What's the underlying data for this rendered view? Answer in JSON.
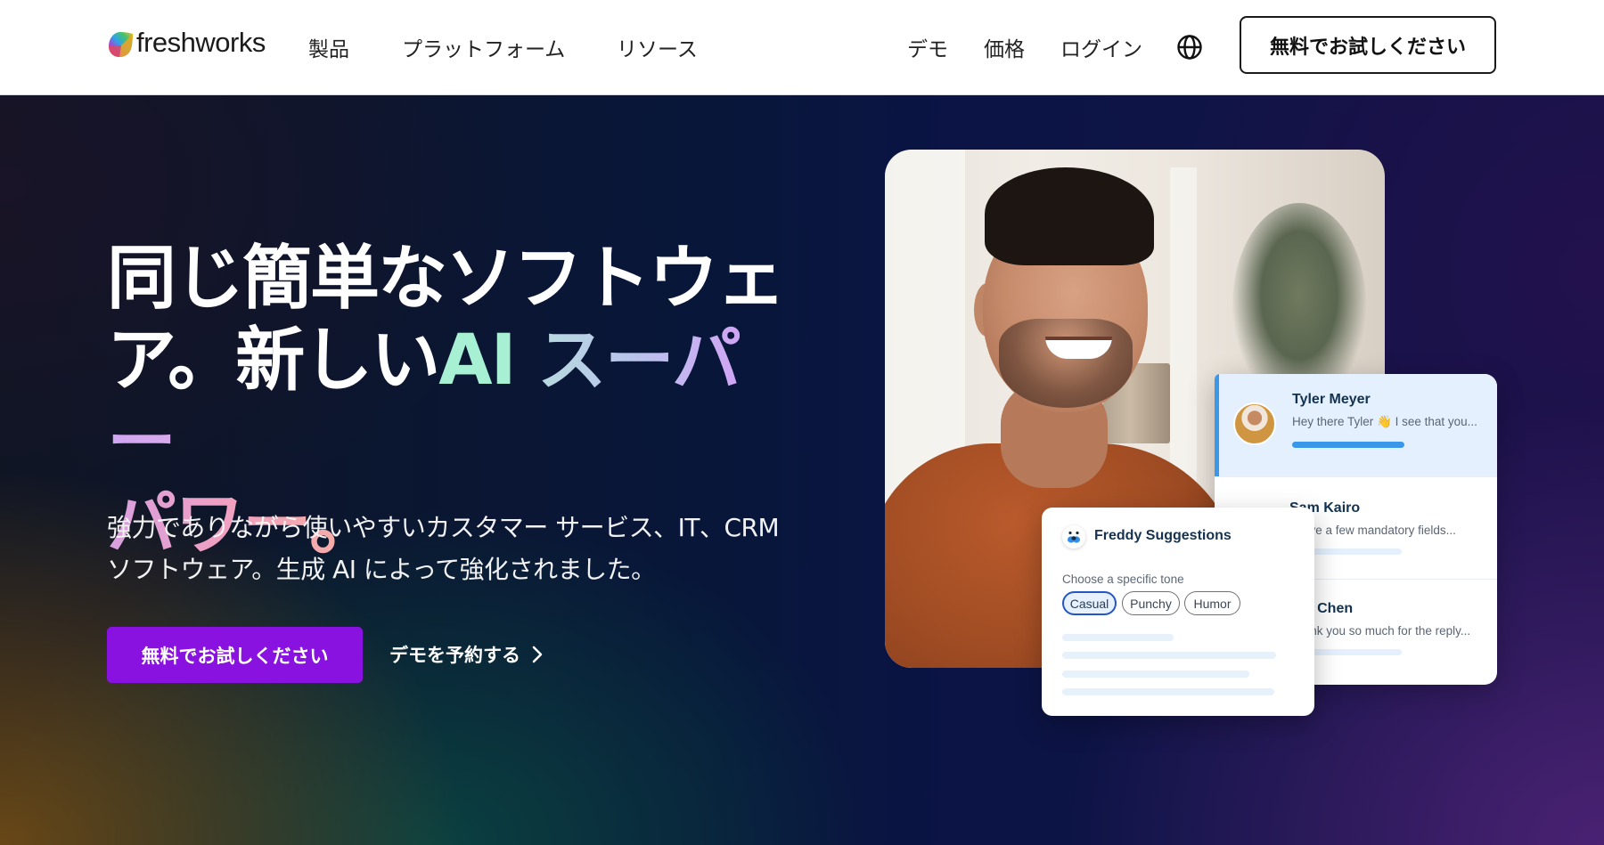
{
  "header": {
    "logo_text": "freshworks",
    "nav": [
      {
        "label": "製品"
      },
      {
        "label": "プラットフォーム"
      },
      {
        "label": "リソース"
      }
    ],
    "right_links": [
      {
        "label": "デモ"
      },
      {
        "label": "価格"
      },
      {
        "label": "ログイン"
      }
    ],
    "language_icon": "globe-icon",
    "cta_label": "無料でお試しください"
  },
  "hero": {
    "headline": {
      "part1": "同じ簡単なソフトウェア。新しい",
      "ai": "AI",
      "super": " スーパー",
      "power": "パワー。"
    },
    "subtitle": "強力でありながら使いやすいカスタマー サービス、IT、CRM ソフトウェア。生成 AI によって強化されました。",
    "cta_label": "無料でお試しください",
    "demo_label": "デモを予約する",
    "demo_icon": "chevron-right-icon"
  },
  "chat_list": {
    "items": [
      {
        "name": "Tyler Meyer",
        "message": "Hey there Tyler 👋 I see that you...",
        "active": true
      },
      {
        "name": "Sam Kairo",
        "message": "I have a few mandatory fields...",
        "active": false
      },
      {
        "name": "Mia Chen",
        "message": "Thank you so much for the reply...",
        "active": false
      }
    ]
  },
  "freddy": {
    "title": "Freddy Suggestions",
    "tone_label": "Choose a specific tone",
    "tones": [
      {
        "label": "Casual",
        "selected": true
      },
      {
        "label": "Punchy",
        "selected": false
      },
      {
        "label": "Humor",
        "selected": false
      }
    ]
  },
  "colors": {
    "primary_purple": "#8a12e0",
    "chat_accent_blue": "#3b97e8",
    "chip_selected_border": "#2455c3",
    "hero_base": "#08163a"
  }
}
